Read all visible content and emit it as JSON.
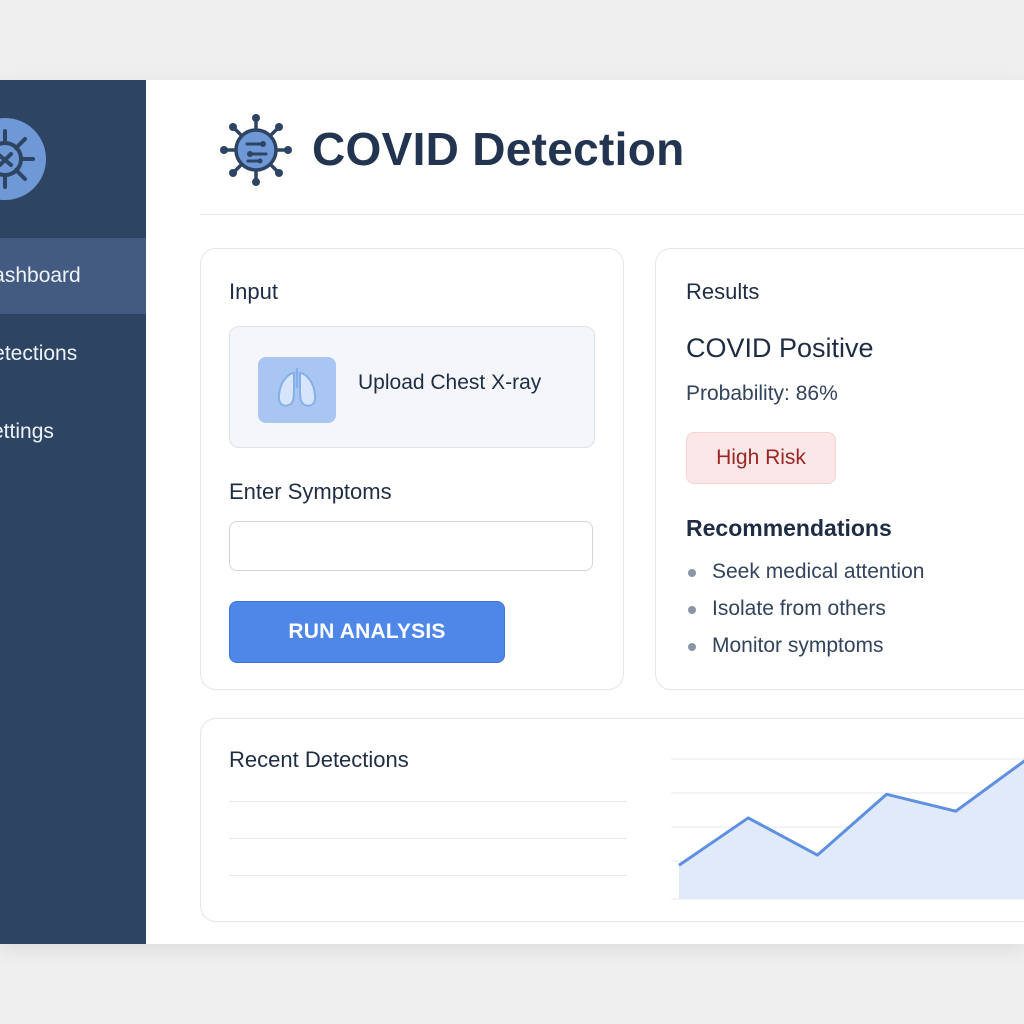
{
  "app": {
    "title": "COVID Detection"
  },
  "sidebar": {
    "items": [
      {
        "label": "Dashboard",
        "active": true
      },
      {
        "label": "Detections",
        "active": false
      },
      {
        "label": "Settings",
        "active": false
      }
    ]
  },
  "input_card": {
    "title": "Input",
    "upload_label": "Upload Chest X-ray",
    "symptoms_label": "Enter Symptoms",
    "symptoms_value": "",
    "symptoms_placeholder": "",
    "run_button": "RUN ANALYSIS"
  },
  "results_card": {
    "title": "Results",
    "status": "COVID Positive",
    "probability_label": "Probability:",
    "probability_value": "86%",
    "risk_badge": "High Risk",
    "recommendations_title": "Recommendations",
    "recommendations": [
      "Seek medical attention",
      "Isolate from others",
      "Monitor symptoms"
    ]
  },
  "recent_card": {
    "title": "Recent Detections"
  },
  "chart_data": {
    "type": "area",
    "title": "",
    "xlabel": "",
    "ylabel": "",
    "grid": true,
    "values": [
      1,
      2.4,
      1.3,
      3.1,
      2.6,
      4.1
    ],
    "ylim": [
      0,
      4.5
    ]
  },
  "colors": {
    "sidebar": "#2e4463",
    "accent": "#4f87e8",
    "risk": "#9a2626",
    "chart_line": "#5f8fe0",
    "chart_fill": "#e1eafa"
  },
  "icons": {
    "logo": "virus-icon",
    "upload": "lungs-icon",
    "bullet": "bullet-dot"
  }
}
